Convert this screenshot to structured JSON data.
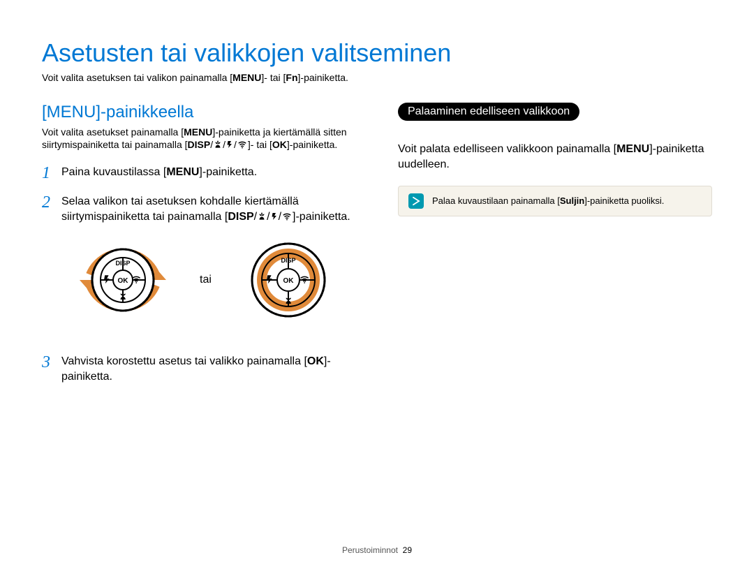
{
  "page_title": "Asetusten tai valikkojen valitseminen",
  "lead_pre": "Voit valita asetuksen tai valikon painamalla [",
  "lead_menu": "MENU",
  "lead_mid": "]- tai [",
  "lead_fn": "Fn",
  "lead_post": "]-painiketta.",
  "left": {
    "heading": "[MENU]-painikkeella",
    "intro_a": "Voit valita asetukset painamalla [",
    "intro_b": "]-painiketta ja kiertämällä sitten siirtymispainiketta tai painamalla [",
    "intro_c": "]- tai [",
    "intro_d": "]-painiketta.",
    "step1_a": "Paina kuvaustilassa [",
    "step1_b": "]-painiketta.",
    "step2": "Selaa valikon tai asetuksen kohdalle kiertämällä siirtymispainiketta tai painamalla [",
    "step2_b": "]-painiketta.",
    "tai": "tai",
    "step3_a": "Vahvista korostettu asetus tai valikko painamalla [",
    "step3_b": "]-painiketta.",
    "disp": "DISP",
    "ok": "OK",
    "menu": "MENU"
  },
  "right": {
    "pill": "Palaaminen edelliseen valikkoon",
    "body_a": "Voit palata edelliseen valikkoon painamalla [",
    "body_b": "]-painiketta uudelleen.",
    "menu": "MENU",
    "note_a": "Palaa kuvaustilaan painamalla [",
    "note_btn": "Suljin",
    "note_b": "]-painiketta puoliksi."
  },
  "footer_section": "Perustoiminnot",
  "footer_page": "29"
}
